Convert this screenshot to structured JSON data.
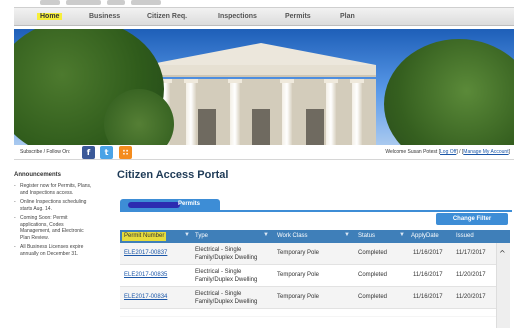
{
  "nav": {
    "items": [
      "Home",
      "Business",
      "Citizen Req.",
      "Inspections",
      "Permits",
      "Plan"
    ],
    "active_index": 0
  },
  "hero": {
    "subscribe_text": "Subscribe / Follow On:",
    "social": [
      {
        "icon": "facebook-icon",
        "glyph": "f"
      },
      {
        "icon": "twitter-icon",
        "glyph": "t"
      },
      {
        "icon": "rss-icon",
        "glyph": "∷"
      }
    ],
    "welcome_text": "Welcome Susan Potest [",
    "logout_label": "Log Off",
    "separator": "] / [",
    "manage_label": "Manage My Account",
    "end": "]"
  },
  "announcements": {
    "title": "Announcements",
    "items": [
      "Register now for Permits, Plans, and Inspections access.",
      "Online Inspections scheduling starts Aug. 14.",
      "Coming Soon: Permit applications, Codes Management, and Electronic Plan Review.",
      "All Business Licenses expire annually on December 31."
    ]
  },
  "main": {
    "title": "Citizen Access Portal",
    "tab_label": "Permits",
    "change_filter_label": "Change Filter"
  },
  "grid": {
    "columns": [
      "Permit Number",
      "Type",
      "Work Class",
      "Status",
      "ApplyDate",
      "Issued"
    ],
    "rows": [
      {
        "permit": "ELE2017-00837",
        "type": [
          "Electrical - Single",
          "Family/Duplex Dwelling"
        ],
        "work_class": "Temporary Pole",
        "status": "Completed",
        "apply": "11/16/2017",
        "issued": "11/17/2017"
      },
      {
        "permit": "ELE2017-00835",
        "type": [
          "Electrical - Single",
          "Family/Duplex Dwelling"
        ],
        "work_class": "Temporary Pole",
        "status": "Completed",
        "apply": "11/16/2017",
        "issued": "11/20/2017"
      },
      {
        "permit": "ELE2017-00834",
        "type": [
          "Electrical - Single",
          "Family/Duplex Dwelling"
        ],
        "work_class": "Temporary Pole",
        "status": "Completed",
        "apply": "11/16/2017",
        "issued": "11/20/2017"
      }
    ],
    "scroll_up_glyph": "^"
  },
  "colors": {
    "nav_active_highlight": "#f7ef3a",
    "header_blue": "#3f7fb9",
    "tab_blue": "#3d8dd6",
    "title_color": "#1f3b57"
  }
}
